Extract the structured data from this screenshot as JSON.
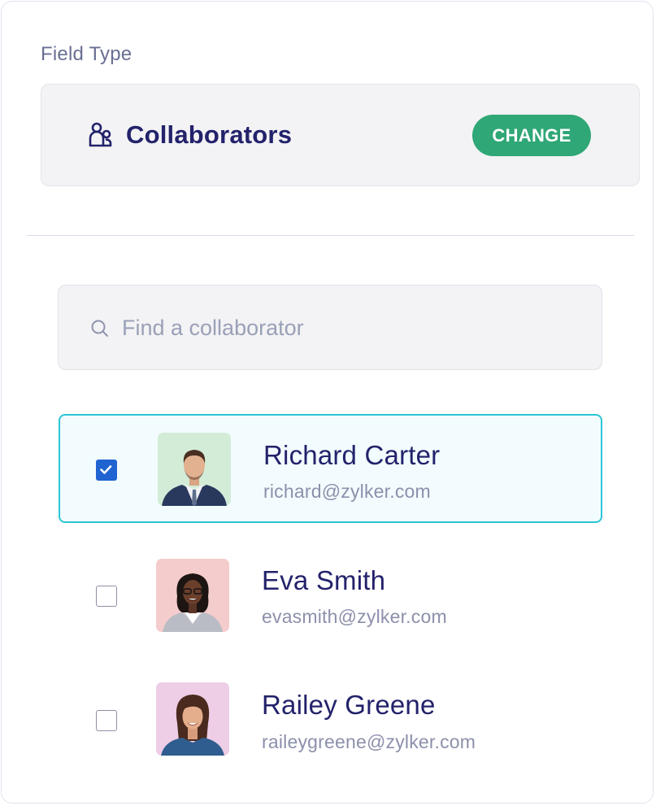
{
  "field_type": {
    "label": "Field Type",
    "value": "Collaborators",
    "icon": "collaborators-icon",
    "change_button": "CHANGE"
  },
  "search": {
    "placeholder": "Find a collaborator",
    "value": "",
    "icon": "search-icon"
  },
  "collaborators": [
    {
      "name": "Richard Carter",
      "email": "richard@zylker.com",
      "checked": true
    },
    {
      "name": "Eva Smith",
      "email": "evasmith@zylker.com",
      "checked": false
    },
    {
      "name": "Railey Greene",
      "email": "raileygreene@zylker.com",
      "checked": false
    }
  ],
  "colors": {
    "accent_green": "#2fa776",
    "selected_border": "#2bc6d6",
    "checkbox_blue": "#1f64d0",
    "text_primary": "#23226b"
  }
}
